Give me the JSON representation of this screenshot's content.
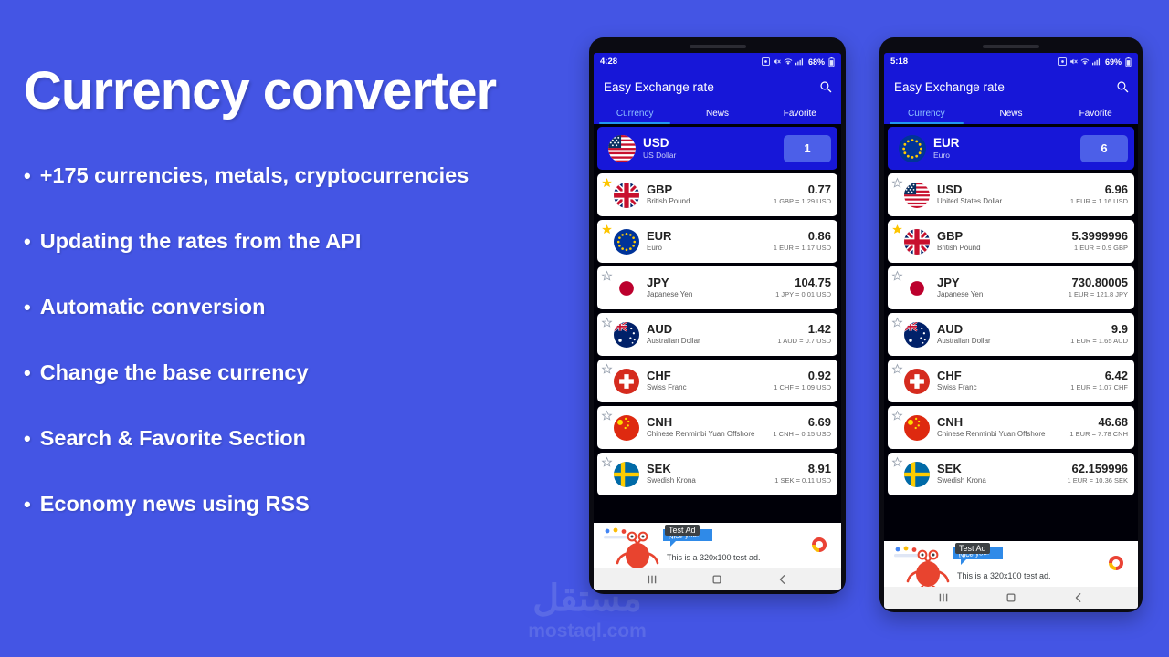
{
  "theme": {
    "background": "#4455e4",
    "app_blue": "#1717d8",
    "screen_blue": "#0a0ad0",
    "accent": "#2196f3",
    "base_chip": "#4c5fe8"
  },
  "promo": {
    "headline": "Currency converter",
    "bullets": [
      "+175 currencies, metals, cryptocurrencies",
      "Updating the rates from the API",
      "Automatic conversion",
      "Change the base currency",
      "Search & Favorite Section",
      "Economy news using RSS"
    ],
    "bullet_marker": "•"
  },
  "watermark": {
    "arabic": "مستقل",
    "latin": "mostaql.com"
  },
  "phones": [
    {
      "id": "phone-1",
      "status": {
        "time": "4:28",
        "battery": "68%",
        "icons": [
          "screenshot-icon",
          "mute-icon",
          "wifi-icon",
          "signal-icon",
          "battery-icon"
        ]
      },
      "app_bar": {
        "title": "Easy Exchange rate",
        "search_icon": "search-icon"
      },
      "tabs": [
        {
          "label": "Currency",
          "active": true
        },
        {
          "label": "News",
          "active": false
        },
        {
          "label": "Favorite",
          "active": false
        }
      ],
      "base_row": {
        "code": "USD",
        "name": "US Dollar",
        "amount": "1",
        "flag": "us"
      },
      "rows": [
        {
          "code": "GBP",
          "name": "British Pound",
          "value": "0.77",
          "rate": "1 GBP = 1.29 USD",
          "favorite": true,
          "flag": "gb"
        },
        {
          "code": "EUR",
          "name": "Euro",
          "value": "0.86",
          "rate": "1 EUR = 1.17 USD",
          "favorite": true,
          "flag": "eu"
        },
        {
          "code": "JPY",
          "name": "Japanese Yen",
          "value": "104.75",
          "rate": "1 JPY = 0.01 USD",
          "favorite": false,
          "flag": "jp"
        },
        {
          "code": "AUD",
          "name": "Australian Dollar",
          "value": "1.42",
          "rate": "1 AUD = 0.7 USD",
          "favorite": false,
          "flag": "au"
        },
        {
          "code": "CHF",
          "name": "Swiss Franc",
          "value": "0.92",
          "rate": "1 CHF = 1.09 USD",
          "favorite": false,
          "flag": "ch"
        },
        {
          "code": "CNH",
          "name": "Chinese Renminbi Yuan Offshore",
          "value": "6.69",
          "rate": "1 CNH = 0.15 USD",
          "favorite": false,
          "flag": "cn"
        },
        {
          "code": "SEK",
          "name": "Swedish Krona",
          "value": "8.91",
          "rate": "1 SEK = 0.11 USD",
          "favorite": false,
          "flag": "se"
        }
      ],
      "ad": {
        "badge": "Test Ad",
        "bubble": "Nice you!",
        "text": "This is a 320x100 test ad."
      },
      "nav": [
        "recents-icon",
        "home-icon",
        "back-icon"
      ]
    },
    {
      "id": "phone-2",
      "status": {
        "time": "5:18",
        "battery": "69%",
        "icons": [
          "screenshot-icon",
          "mute-icon",
          "wifi-icon",
          "signal-icon",
          "battery-icon"
        ]
      },
      "app_bar": {
        "title": "Easy Exchange rate",
        "search_icon": "search-icon"
      },
      "tabs": [
        {
          "label": "Currency",
          "active": true
        },
        {
          "label": "News",
          "active": false
        },
        {
          "label": "Favorite",
          "active": false
        }
      ],
      "base_row": {
        "code": "EUR",
        "name": "Euro",
        "amount": "6",
        "flag": "eu"
      },
      "rows": [
        {
          "code": "USD",
          "name": "United States Dollar",
          "value": "6.96",
          "rate": "1 EUR = 1.16 USD",
          "favorite": false,
          "flag": "us"
        },
        {
          "code": "GBP",
          "name": "British Pound",
          "value": "5.3999996",
          "rate": "1 EUR = 0.9 GBP",
          "favorite": true,
          "flag": "gb"
        },
        {
          "code": "JPY",
          "name": "Japanese Yen",
          "value": "730.80005",
          "rate": "1 EUR = 121.8 JPY",
          "favorite": false,
          "flag": "jp"
        },
        {
          "code": "AUD",
          "name": "Australian Dollar",
          "value": "9.9",
          "rate": "1 EUR = 1.65 AUD",
          "favorite": false,
          "flag": "au"
        },
        {
          "code": "CHF",
          "name": "Swiss Franc",
          "value": "6.42",
          "rate": "1 EUR = 1.07 CHF",
          "favorite": false,
          "flag": "ch"
        },
        {
          "code": "CNH",
          "name": "Chinese Renminbi Yuan Offshore",
          "value": "46.68",
          "rate": "1 EUR = 7.78 CNH",
          "favorite": false,
          "flag": "cn"
        },
        {
          "code": "SEK",
          "name": "Swedish Krona",
          "value": "62.159996",
          "rate": "1 EUR = 10.36 SEK",
          "favorite": false,
          "flag": "se"
        }
      ],
      "ad": {
        "badge": "Test Ad",
        "bubble": "Nice you!",
        "text": "This is a 320x100 test ad."
      },
      "nav": [
        "recents-icon",
        "home-icon",
        "back-icon"
      ]
    }
  ]
}
